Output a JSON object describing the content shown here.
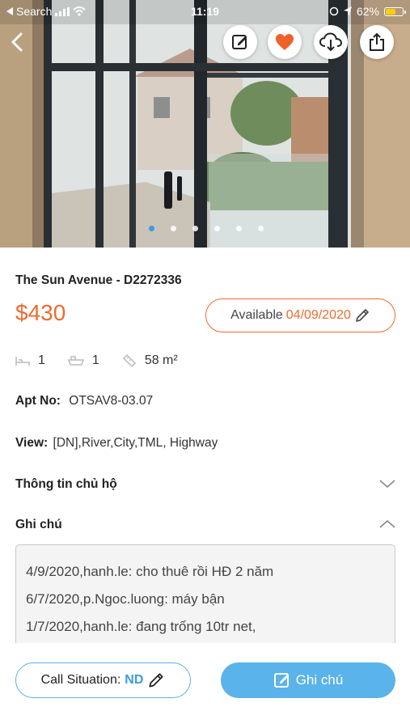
{
  "status_bar": {
    "back_app": "Search",
    "time": "11:19",
    "battery": "62%",
    "battery_level": 0.62
  },
  "header": {
    "icons": [
      "chevron-left-icon",
      "edit-icon",
      "heart-icon",
      "cloud-download-icon",
      "share-icon"
    ],
    "carousel_pages": 6,
    "carousel_active": 0
  },
  "listing": {
    "title": "The Sun Avenue - D2272336",
    "price": "$430",
    "availability_label": "Available",
    "availability_date": "04/09/2020",
    "bedrooms": "1",
    "bathrooms": "1",
    "area": "58 m²",
    "apt_no_label": "Apt No:",
    "apt_no": "OTSAV8-03.07",
    "view_label": "View:",
    "view": "[DN],River,City,TML, Highway"
  },
  "sections": {
    "owner_info": "Thông tin chủ hộ",
    "notes": "Ghi chú"
  },
  "notes": [
    "4/9/2020,hanh.le: cho thuê rồi HĐ 2 năm",
    "6/7/2020,p.Ngoc.luong: máy bận",
    "1/7/2020,hanh.le: đang trống 10tr net,"
  ],
  "bottom": {
    "call_situation_label": "Call Situation:",
    "call_situation_value": "ND",
    "note_button": "Ghi chú"
  },
  "colors": {
    "accent_orange": "#ee6b2f",
    "accent_blue": "#5ab3ea",
    "favorite_red": "#f0622a"
  }
}
